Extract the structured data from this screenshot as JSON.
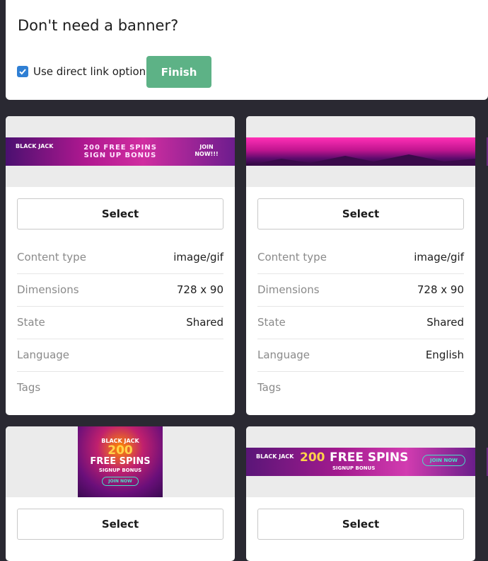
{
  "top": {
    "title": "Don't need a banner?",
    "checkbox_label": "Use direct link option",
    "checkbox_checked": true,
    "finish_label": "Finish"
  },
  "cards": [
    {
      "banner_text": "200 FREE SPINS SIGN UP BONUS",
      "banner_logo": "BLACK JACK",
      "banner_cta": "JOIN NOW!!!",
      "select_label": "Select",
      "rows": [
        {
          "label": "Content type",
          "value": "image/gif"
        },
        {
          "label": "Dimensions",
          "value": "728 x 90"
        },
        {
          "label": "State",
          "value": "Shared"
        },
        {
          "label": "Language",
          "value": ""
        },
        {
          "label": "Tags",
          "value": ""
        }
      ]
    },
    {
      "select_label": "Select",
      "rows": [
        {
          "label": "Content type",
          "value": "image/gif"
        },
        {
          "label": "Dimensions",
          "value": "728 x 90"
        },
        {
          "label": "State",
          "value": "Shared"
        },
        {
          "label": "Language",
          "value": "English"
        },
        {
          "label": "Tags",
          "value": ""
        }
      ]
    },
    {
      "banner_logo": "BLACK JACK",
      "banner_big": "200",
      "banner_text": "FREE SPINS",
      "banner_sub": "SIGNUP BONUS",
      "banner_cta": "JOIN NOW",
      "select_label": "Select"
    },
    {
      "banner_logo": "BLACK JACK",
      "banner_big": "200",
      "banner_text": "FREE SPINS",
      "banner_sub": "SIGNUP BONUS",
      "banner_cta": "JOIN NOW",
      "select_label": "Select"
    }
  ],
  "colors": {
    "background": "#2a2932",
    "finish": "#5db286",
    "checkbox": "#2f7fd4"
  }
}
